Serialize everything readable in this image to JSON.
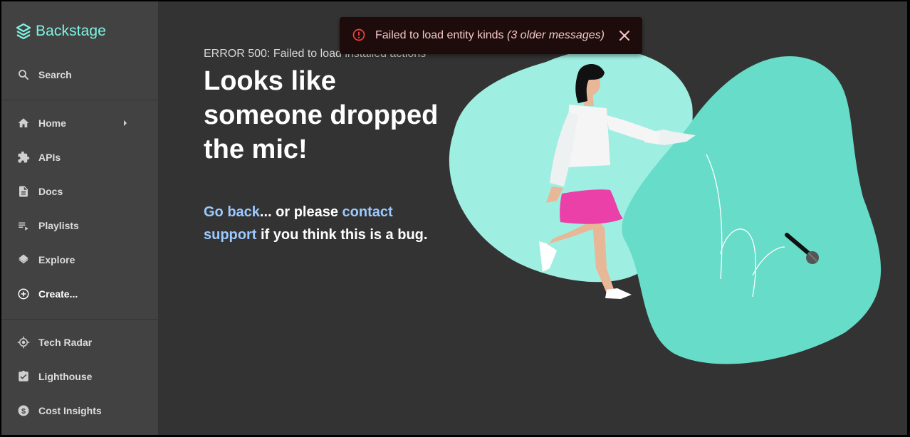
{
  "app": {
    "name": "Backstage"
  },
  "sidebar": {
    "search_label": "Search",
    "items": [
      {
        "label": "Home",
        "icon": "home-icon",
        "has_submenu": true
      },
      {
        "label": "APIs",
        "icon": "puzzle-icon"
      },
      {
        "label": "Docs",
        "icon": "document-icon"
      },
      {
        "label": "Playlists",
        "icon": "playlist-icon"
      },
      {
        "label": "Explore",
        "icon": "layers-icon"
      },
      {
        "label": "Create...",
        "icon": "add-circle-icon"
      }
    ],
    "plugins": [
      {
        "label": "Tech Radar",
        "icon": "radar-icon"
      },
      {
        "label": "Lighthouse",
        "icon": "lighthouse-icon"
      },
      {
        "label": "Cost Insights",
        "icon": "money-icon"
      }
    ]
  },
  "error_page": {
    "status": "ERROR 500: Failed to load installed actions",
    "headline": "Looks like someone dropped the mic!",
    "go_back": "Go back",
    "middle": "... or please ",
    "contact": "contact support",
    "tail": " if you think this is a bug."
  },
  "snackbar": {
    "message": "Failed to load entity kinds",
    "older": "(3 older messages)",
    "icon": "error-outline-icon"
  },
  "colors": {
    "brand": "#7df3e1",
    "link": "#9cc9ff",
    "sidebar_bg": "#424242",
    "page_bg": "#333333",
    "snackbar_bg": "#1e0c0c",
    "error": "#f44336"
  }
}
